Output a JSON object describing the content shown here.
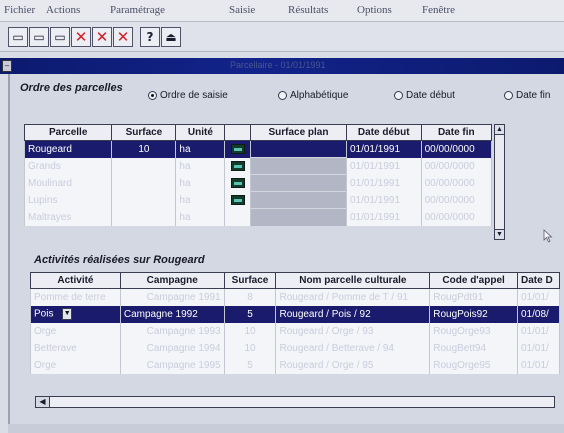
{
  "menu": [
    "Fichier",
    "Actions",
    "Paramétrage",
    "Saisie",
    "Résultats",
    "Options",
    "Fenêtre"
  ],
  "toolbar": {
    "buttons": [
      {
        "name": "new-doc-button",
        "glyph": "▭"
      },
      {
        "name": "open-button",
        "glyph": "▭"
      },
      {
        "name": "copy-button",
        "glyph": "▭"
      },
      {
        "name": "delete-button-1",
        "glyph": "✕"
      },
      {
        "name": "delete-button-2",
        "glyph": "✕"
      },
      {
        "name": "delete-button-3",
        "glyph": "✕"
      },
      {
        "name": "help-button",
        "glyph": "?"
      },
      {
        "name": "exit-button",
        "glyph": "⏏"
      }
    ]
  },
  "window": {
    "title": "Parcellaire - 01/01/1991"
  },
  "parcelles": {
    "section_title": "Ordre des parcelles",
    "sort_options": [
      {
        "label": "Ordre de saisie",
        "selected": true
      },
      {
        "label": "Alphabétique",
        "selected": false
      },
      {
        "label": "Date début",
        "selected": false
      },
      {
        "label": "Date fin",
        "selected": false
      }
    ],
    "columns": [
      "Parcelle",
      "Surface",
      "Unité",
      "",
      "Surface plan",
      "Date début",
      "Date fin"
    ],
    "rows": [
      {
        "parcelle": "Rougeard",
        "surface": "10",
        "unite": "ha",
        "plan": "",
        "debut": "01/01/1991",
        "fin": "00/00/0000",
        "selected": true
      },
      {
        "parcelle": "Grands",
        "surface": "",
        "unite": "ha",
        "plan": "",
        "debut": "01/01/1991",
        "fin": "00/00/0000",
        "selected": false
      },
      {
        "parcelle": "Moulinard",
        "surface": "",
        "unite": "ha",
        "plan": "",
        "debut": "01/01/1991",
        "fin": "00/00/0000",
        "selected": false
      },
      {
        "parcelle": "Lupins",
        "surface": "",
        "unite": "ha",
        "plan": "",
        "debut": "01/01/1991",
        "fin": "00/00/0000",
        "selected": false
      },
      {
        "parcelle": "Maltrayes",
        "surface": "",
        "unite": "ha",
        "plan": "",
        "debut": "01/01/1991",
        "fin": "00/00/0000",
        "selected": false
      }
    ]
  },
  "activites": {
    "section_title": "Activités réalisées sur Rougeard",
    "columns": [
      "Activité",
      "Campagne",
      "Surface",
      "Nom parcelle culturale",
      "Code d'appel",
      "Date D"
    ],
    "rows": [
      {
        "activite": "Pomme de terre",
        "campagne": "Campagne 1991",
        "surface": "8",
        "nom": "Rougeard / Pomme de T / 91",
        "code": "RougPdt91",
        "date": "01/01/",
        "selected": false
      },
      {
        "activite": "Pois",
        "campagne": "Campagne 1992",
        "surface": "5",
        "nom": "Rougeard / Pois / 92",
        "code": "RougPois92",
        "date": "01/08/",
        "selected": true
      },
      {
        "activite": "Orge",
        "campagne": "Campagne 1993",
        "surface": "10",
        "nom": "Rougeard / Orge / 93",
        "code": "RougOrge93",
        "date": "01/01/",
        "selected": false
      },
      {
        "activite": "Betterave",
        "campagne": "Campagne 1994",
        "surface": "10",
        "nom": "Rougeard / Betterave / 94",
        "code": "RougBett94",
        "date": "01/01/",
        "selected": false
      },
      {
        "activite": "Orge",
        "campagne": "Campagne 1995",
        "surface": "5",
        "nom": "Rougeard / Orge / 95",
        "code": "RougOrge95",
        "date": "01/01/",
        "selected": false
      }
    ]
  }
}
